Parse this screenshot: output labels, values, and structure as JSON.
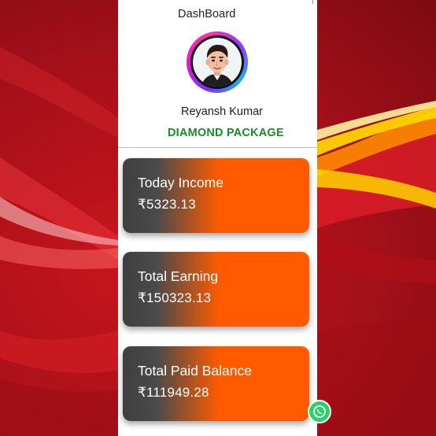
{
  "header": {
    "title": "DashBoard"
  },
  "profile": {
    "name": "Reyansh Kumar",
    "package": "DIAMOND PACKAGE",
    "avatar_icon": "user-avatar-icon"
  },
  "cards": [
    {
      "label": "Today Income",
      "value": "₹5323.13"
    },
    {
      "label": "Total Earning",
      "value": "₹150323.13"
    },
    {
      "label": "Total Paid Balance",
      "value": "₹111949.28"
    }
  ],
  "floating": {
    "icon": "whatsapp-icon"
  },
  "colors": {
    "background_red": "#c8151b",
    "card_orange": "#ff5a00",
    "card_dark": "#3f3f3f",
    "package_green": "#1e8a2a",
    "whatsapp_green": "#25d366"
  }
}
